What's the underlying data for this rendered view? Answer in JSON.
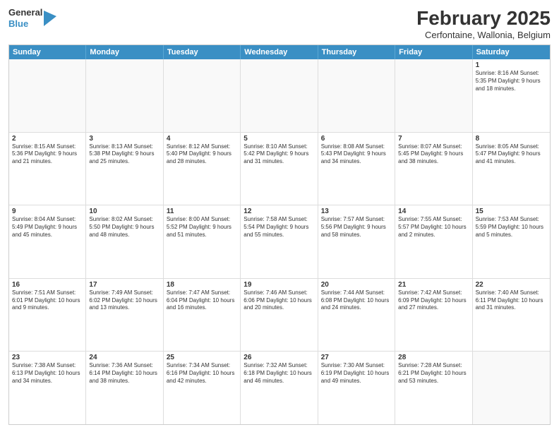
{
  "logo": {
    "line1": "General",
    "line2": "Blue"
  },
  "title": "February 2025",
  "subtitle": "Cerfontaine, Wallonia, Belgium",
  "header_days": [
    "Sunday",
    "Monday",
    "Tuesday",
    "Wednesday",
    "Thursday",
    "Friday",
    "Saturday"
  ],
  "weeks": [
    [
      {
        "day": "",
        "text": ""
      },
      {
        "day": "",
        "text": ""
      },
      {
        "day": "",
        "text": ""
      },
      {
        "day": "",
        "text": ""
      },
      {
        "day": "",
        "text": ""
      },
      {
        "day": "",
        "text": ""
      },
      {
        "day": "1",
        "text": "Sunrise: 8:16 AM\nSunset: 5:35 PM\nDaylight: 9 hours and 18 minutes."
      }
    ],
    [
      {
        "day": "2",
        "text": "Sunrise: 8:15 AM\nSunset: 5:36 PM\nDaylight: 9 hours and 21 minutes."
      },
      {
        "day": "3",
        "text": "Sunrise: 8:13 AM\nSunset: 5:38 PM\nDaylight: 9 hours and 25 minutes."
      },
      {
        "day": "4",
        "text": "Sunrise: 8:12 AM\nSunset: 5:40 PM\nDaylight: 9 hours and 28 minutes."
      },
      {
        "day": "5",
        "text": "Sunrise: 8:10 AM\nSunset: 5:42 PM\nDaylight: 9 hours and 31 minutes."
      },
      {
        "day": "6",
        "text": "Sunrise: 8:08 AM\nSunset: 5:43 PM\nDaylight: 9 hours and 34 minutes."
      },
      {
        "day": "7",
        "text": "Sunrise: 8:07 AM\nSunset: 5:45 PM\nDaylight: 9 hours and 38 minutes."
      },
      {
        "day": "8",
        "text": "Sunrise: 8:05 AM\nSunset: 5:47 PM\nDaylight: 9 hours and 41 minutes."
      }
    ],
    [
      {
        "day": "9",
        "text": "Sunrise: 8:04 AM\nSunset: 5:49 PM\nDaylight: 9 hours and 45 minutes."
      },
      {
        "day": "10",
        "text": "Sunrise: 8:02 AM\nSunset: 5:50 PM\nDaylight: 9 hours and 48 minutes."
      },
      {
        "day": "11",
        "text": "Sunrise: 8:00 AM\nSunset: 5:52 PM\nDaylight: 9 hours and 51 minutes."
      },
      {
        "day": "12",
        "text": "Sunrise: 7:58 AM\nSunset: 5:54 PM\nDaylight: 9 hours and 55 minutes."
      },
      {
        "day": "13",
        "text": "Sunrise: 7:57 AM\nSunset: 5:56 PM\nDaylight: 9 hours and 58 minutes."
      },
      {
        "day": "14",
        "text": "Sunrise: 7:55 AM\nSunset: 5:57 PM\nDaylight: 10 hours and 2 minutes."
      },
      {
        "day": "15",
        "text": "Sunrise: 7:53 AM\nSunset: 5:59 PM\nDaylight: 10 hours and 5 minutes."
      }
    ],
    [
      {
        "day": "16",
        "text": "Sunrise: 7:51 AM\nSunset: 6:01 PM\nDaylight: 10 hours and 9 minutes."
      },
      {
        "day": "17",
        "text": "Sunrise: 7:49 AM\nSunset: 6:02 PM\nDaylight: 10 hours and 13 minutes."
      },
      {
        "day": "18",
        "text": "Sunrise: 7:47 AM\nSunset: 6:04 PM\nDaylight: 10 hours and 16 minutes."
      },
      {
        "day": "19",
        "text": "Sunrise: 7:46 AM\nSunset: 6:06 PM\nDaylight: 10 hours and 20 minutes."
      },
      {
        "day": "20",
        "text": "Sunrise: 7:44 AM\nSunset: 6:08 PM\nDaylight: 10 hours and 24 minutes."
      },
      {
        "day": "21",
        "text": "Sunrise: 7:42 AM\nSunset: 6:09 PM\nDaylight: 10 hours and 27 minutes."
      },
      {
        "day": "22",
        "text": "Sunrise: 7:40 AM\nSunset: 6:11 PM\nDaylight: 10 hours and 31 minutes."
      }
    ],
    [
      {
        "day": "23",
        "text": "Sunrise: 7:38 AM\nSunset: 6:13 PM\nDaylight: 10 hours and 34 minutes."
      },
      {
        "day": "24",
        "text": "Sunrise: 7:36 AM\nSunset: 6:14 PM\nDaylight: 10 hours and 38 minutes."
      },
      {
        "day": "25",
        "text": "Sunrise: 7:34 AM\nSunset: 6:16 PM\nDaylight: 10 hours and 42 minutes."
      },
      {
        "day": "26",
        "text": "Sunrise: 7:32 AM\nSunset: 6:18 PM\nDaylight: 10 hours and 46 minutes."
      },
      {
        "day": "27",
        "text": "Sunrise: 7:30 AM\nSunset: 6:19 PM\nDaylight: 10 hours and 49 minutes."
      },
      {
        "day": "28",
        "text": "Sunrise: 7:28 AM\nSunset: 6:21 PM\nDaylight: 10 hours and 53 minutes."
      },
      {
        "day": "",
        "text": ""
      }
    ]
  ]
}
